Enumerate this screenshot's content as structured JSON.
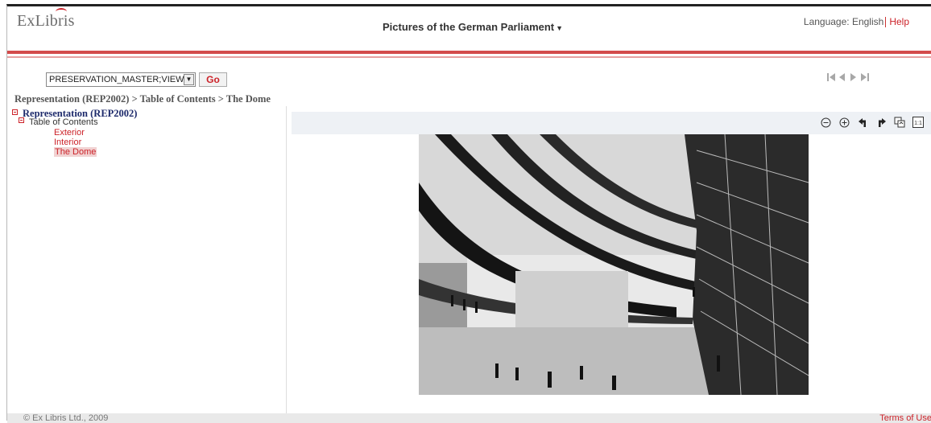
{
  "header": {
    "logo_text": "ExLibris",
    "site_title": "Pictures of the German Parliament",
    "language_label": "Language: English",
    "help_link": "Help"
  },
  "toolbar": {
    "view_select_value": "PRESERVATION_MASTER;VIEW",
    "go_label": "Go",
    "nav_arrows": "|◀ ◀ ▶ ▶|"
  },
  "breadcrumb": "Representation (REP2002) > Table of Contents > The Dome",
  "tree": {
    "root": "Representation (REP2002)",
    "toc": "Table of Contents",
    "items": [
      "Exterior",
      "Interior",
      "The Dome"
    ],
    "selected": "The Dome"
  },
  "viewer": {
    "tools": [
      "zoom-out-icon",
      "zoom-in-icon",
      "rotate-left-icon",
      "rotate-right-icon",
      "fit-window-icon",
      "actual-size-icon"
    ],
    "actual_size_label": "1:1"
  },
  "footer": {
    "copyright": "© Ex Libris Ltd., 2009",
    "terms": "Terms of Use"
  },
  "colors": {
    "accent": "#cc2229",
    "tree_root": "#1d2a6b",
    "viewer_bar": "#eef1f5"
  }
}
